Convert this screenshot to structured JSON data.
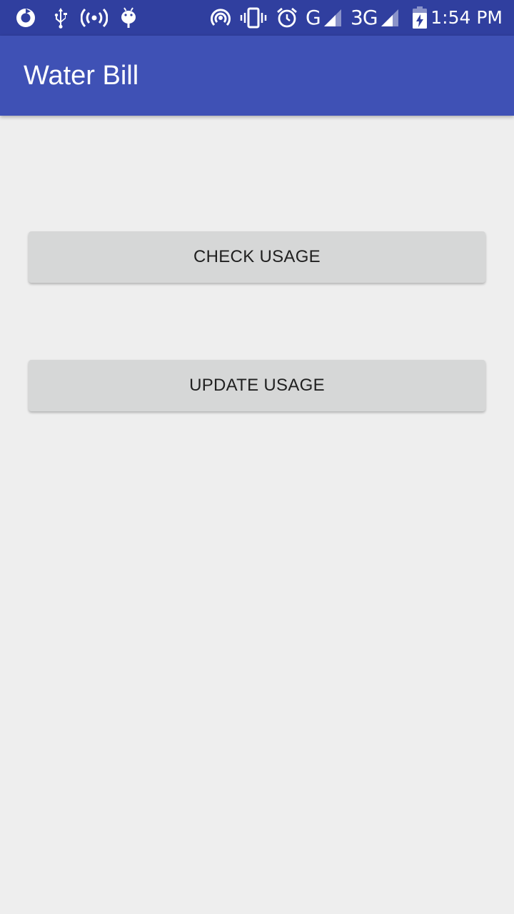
{
  "status_bar": {
    "background": "#303f9f",
    "left_icons": [
      "sync-icon",
      "usb-icon",
      "hotspot-icon",
      "android-debug-icon"
    ],
    "right_icons": [
      "wifi-icon",
      "vibrate-icon",
      "alarm-icon",
      "g-signal-icon",
      "3g-signal-icon",
      "battery-charging-icon"
    ],
    "network_1": "G",
    "network_2": "3G",
    "time": "1:54 PM"
  },
  "app_bar": {
    "background": "#3f51b5",
    "title": "Water Bill"
  },
  "main": {
    "background": "#eeeeee",
    "buttons": [
      {
        "label": "CHECK USAGE"
      },
      {
        "label": "UPDATE USAGE"
      }
    ]
  }
}
